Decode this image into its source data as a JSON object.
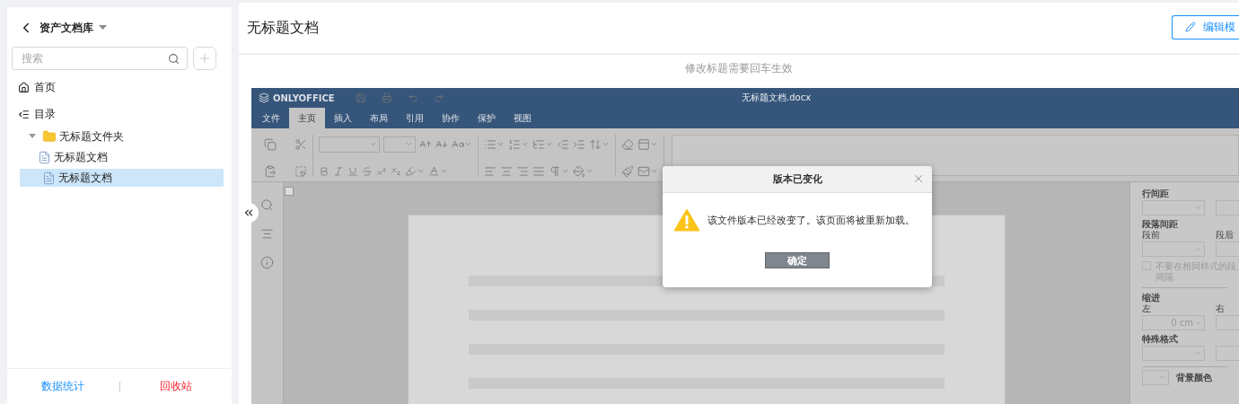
{
  "sidebar": {
    "library": "资产文档库",
    "search": {
      "placeholder": "搜索"
    },
    "nav": [
      {
        "label": "首页",
        "kind": "home"
      },
      {
        "label": "目录",
        "kind": "catalog"
      }
    ],
    "tree": [
      {
        "label": "无标题文件夹",
        "kind": "folder",
        "expanded": true,
        "selected": false,
        "children": [
          {
            "label": "无标题文档",
            "kind": "doc",
            "selected": false
          }
        ]
      },
      {
        "label": "无标题文档",
        "kind": "doc",
        "selected": true
      }
    ],
    "footer": [
      {
        "label": "数据统计",
        "kind": "link"
      },
      {
        "label": "回收站",
        "kind": "danger"
      }
    ]
  },
  "header": {
    "title": "无标题文档",
    "edit_button": "编辑模"
  },
  "hint": "修改标题需要回车生效",
  "editor": {
    "brand": "ONLYOFFICE",
    "file_name": "无标题文档.docx",
    "tabs": [
      {
        "label": "文件",
        "selected": false
      },
      {
        "label": "主页",
        "selected": true
      },
      {
        "label": "插入",
        "selected": false
      },
      {
        "label": "布局",
        "selected": false
      },
      {
        "label": "引用",
        "selected": false
      },
      {
        "label": "协作",
        "selected": false
      },
      {
        "label": "保护",
        "selected": false
      },
      {
        "label": "视图",
        "selected": false
      }
    ],
    "panel": {
      "line_spacing": "行间距",
      "paragraph_spacing": "段落间距",
      "before": "段前",
      "after": "段后",
      "same_style": {
        "lines": [
          "不要在相同样式的段",
          "间隔"
        ],
        "checked": false
      },
      "indent": "缩进",
      "left": "左",
      "right": "右",
      "left_value": "0 cm",
      "special": "特殊格式",
      "background": "背景颜色"
    }
  },
  "dialog": {
    "title": "版本已变化",
    "message": "该文件版本已经改变了。该页面将被重新加载。",
    "ok": "确定"
  }
}
